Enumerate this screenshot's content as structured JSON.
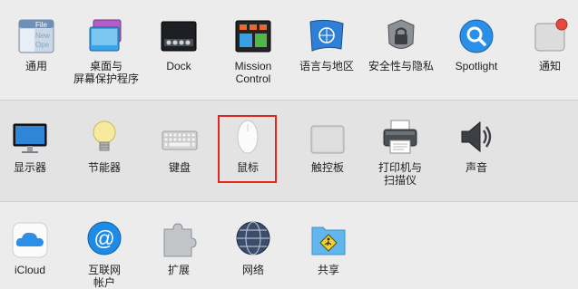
{
  "rows": [
    {
      "items": [
        {
          "label": "通用",
          "icon": "general-icon",
          "icon_text": {
            "file": "File",
            "new": "New",
            "ope": "Ope"
          }
        },
        {
          "label": "桌面与\n屏幕保护程序",
          "icon": "desktop-screensaver-icon"
        },
        {
          "label": "Dock",
          "icon": "dock-icon"
        },
        {
          "label": "Mission\nControl",
          "icon": "mission-control-icon"
        },
        {
          "label": "语言与地区",
          "icon": "language-region-icon"
        },
        {
          "label": "安全性与隐私",
          "icon": "security-privacy-icon"
        },
        {
          "label": "Spotlight",
          "icon": "spotlight-icon"
        },
        {
          "label": "通知",
          "icon": "notifications-icon"
        }
      ]
    },
    {
      "items": [
        {
          "label": "显示器",
          "icon": "displays-icon"
        },
        {
          "label": "节能器",
          "icon": "energy-saver-icon"
        },
        {
          "label": "键盘",
          "icon": "keyboard-icon"
        },
        {
          "label": "鼠标",
          "icon": "mouse-icon"
        },
        {
          "label": "触控板",
          "icon": "trackpad-icon"
        },
        {
          "label": "打印机与\n扫描仪",
          "icon": "printers-scanners-icon"
        },
        {
          "label": "声音",
          "icon": "sound-icon"
        }
      ]
    },
    {
      "items": [
        {
          "label": "iCloud",
          "icon": "icloud-icon"
        },
        {
          "label": "互联网\n帐户",
          "icon": "internet-accounts-icon"
        },
        {
          "label": "扩展",
          "icon": "extensions-icon"
        },
        {
          "label": "网络",
          "icon": "network-icon"
        },
        {
          "label": "共享",
          "icon": "sharing-icon"
        }
      ]
    }
  ],
  "highlighted": "鼠标",
  "colors": {
    "highlight": "#e2251f",
    "accent_blue": "#1e88e5"
  }
}
